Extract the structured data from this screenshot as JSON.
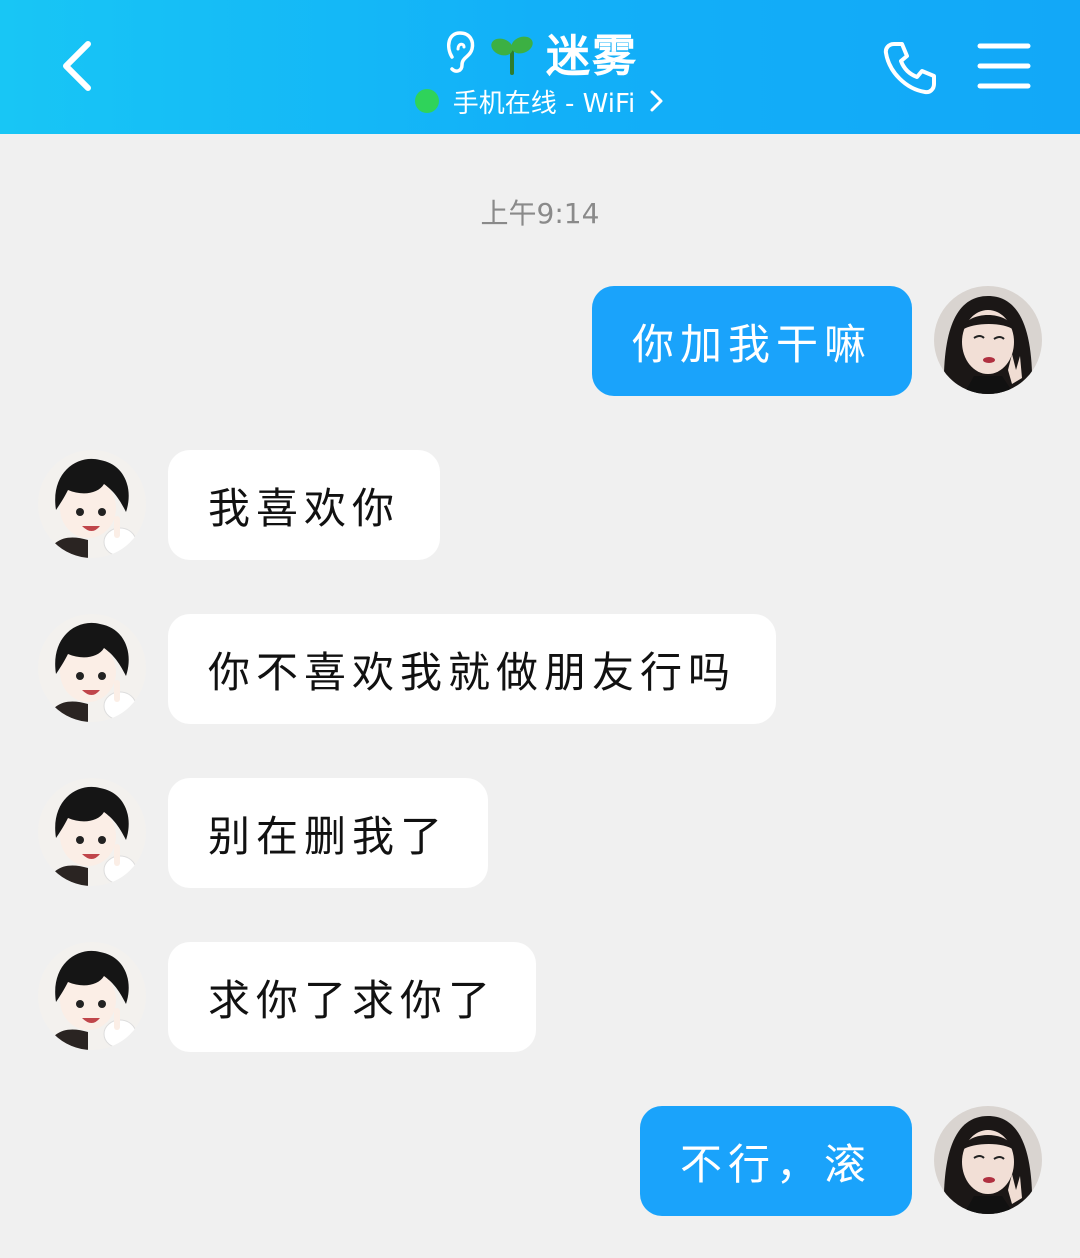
{
  "header": {
    "title": "迷雾",
    "status": "手机在线 - WiFi",
    "icons": {
      "back": "chevron-left-icon",
      "ear": "ear-icon",
      "sprout": "sprout-icon",
      "phone": "phone-icon",
      "menu": "menu-icon"
    },
    "colors": {
      "accent": "#12b0f8",
      "online": "#2fd35a"
    }
  },
  "chat": {
    "timestamp": "上午9:14",
    "messages": [
      {
        "side": "out",
        "text": "你加我干嘛"
      },
      {
        "side": "in",
        "text": "我喜欢你"
      },
      {
        "side": "in",
        "text": "你不喜欢我就做朋友行吗"
      },
      {
        "side": "in",
        "text": "别在删我了"
      },
      {
        "side": "in",
        "text": "求你了求你了"
      },
      {
        "side": "out",
        "text": "不行，滚"
      }
    ],
    "colors": {
      "outgoing_bubble": "#1aa3fb",
      "incoming_bubble": "#ffffff",
      "background": "#f0f0f0"
    }
  }
}
